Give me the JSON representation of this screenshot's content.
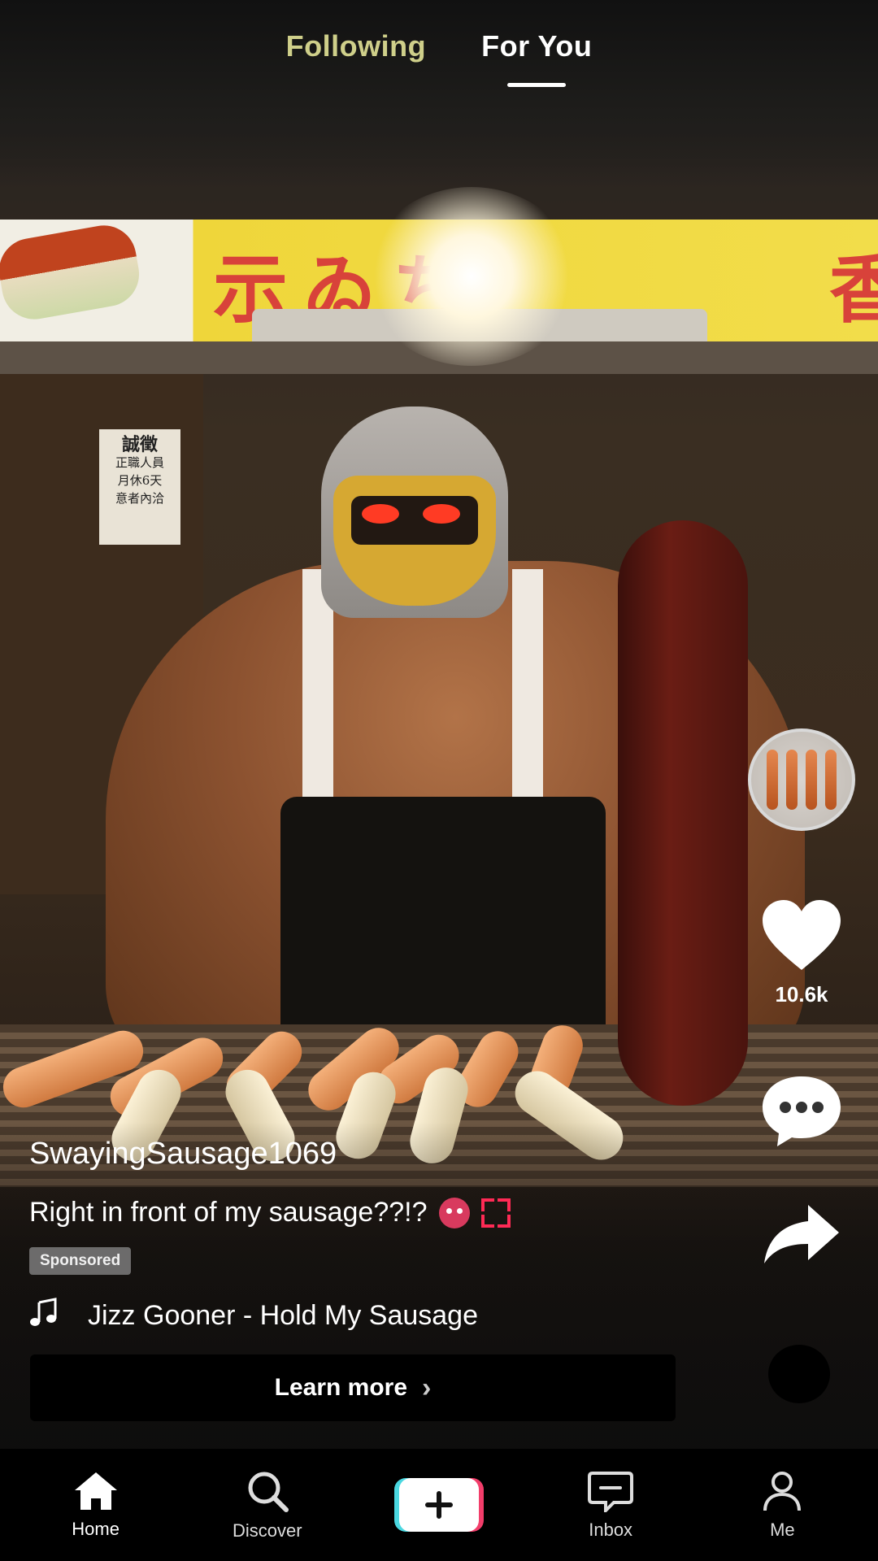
{
  "top_tabs": {
    "following": "Following",
    "for_you": "For You",
    "active": "For You"
  },
  "video": {
    "scene": {
      "sign_chars": [
        "示",
        "ゐ",
        "ち",
        "香"
      ],
      "notice_lines": [
        "誠徵",
        "正職人員",
        "月休6天",
        "意者內洽"
      ]
    }
  },
  "rail": {
    "like_count": "10.6k"
  },
  "post": {
    "username": "SwayingSausage1069",
    "caption": "Right in front of my sausage??!?",
    "sponsored_label": "Sponsored",
    "music_title": "Jizz Gooner - Hold My Sausage",
    "cta_label": "Learn more",
    "cta_chevron": "›"
  },
  "nav": {
    "items": [
      {
        "label": "Home",
        "icon": "home-icon",
        "active": true
      },
      {
        "label": "Discover",
        "icon": "search-icon",
        "active": false
      },
      {
        "label": "",
        "icon": "create-icon",
        "active": false
      },
      {
        "label": "Inbox",
        "icon": "inbox-icon",
        "active": false
      },
      {
        "label": "Me",
        "icon": "profile-icon",
        "active": false
      }
    ]
  },
  "colors": {
    "accent_cyan": "#4ad7e0",
    "accent_pink": "#f23d6a",
    "following_tab": "#cfcf8a"
  }
}
